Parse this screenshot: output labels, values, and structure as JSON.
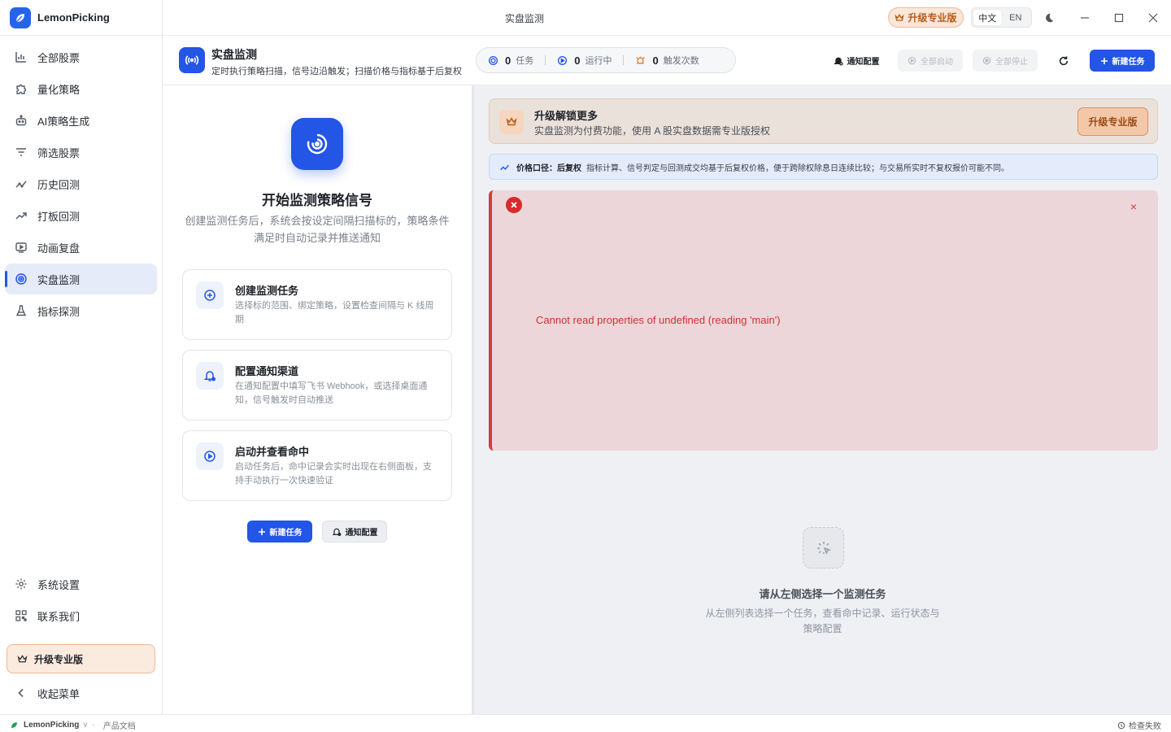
{
  "app": {
    "name": "LemonPicking",
    "window_title": "实盘监测"
  },
  "titlebar": {
    "pro_label": "升级专业版",
    "lang_zh": "中文",
    "lang_en": "EN"
  },
  "sidebar": {
    "items": [
      {
        "label": "全部股票",
        "icon": "bar-chart-icon"
      },
      {
        "label": "量化策略",
        "icon": "puzzle-icon"
      },
      {
        "label": "AI策略生成",
        "icon": "robot-icon"
      },
      {
        "label": "筛选股票",
        "icon": "filter-icon"
      },
      {
        "label": "历史回测",
        "icon": "trend-line-icon"
      },
      {
        "label": "打板回测",
        "icon": "trend-up-icon"
      },
      {
        "label": "动画复盘",
        "icon": "play-screen-icon"
      },
      {
        "label": "实盘监测",
        "icon": "radar-icon",
        "active": true
      },
      {
        "label": "指标探测",
        "icon": "flask-icon"
      }
    ],
    "settings_label": "系统设置",
    "contact_label": "联系我们",
    "upgrade_label": "升级专业版",
    "collapse_label": "收起菜单"
  },
  "header": {
    "title": "实盘监测",
    "subtitle": "定时执行策略扫描，信号边沿触发；扫描价格与指标基于后复权",
    "stats": [
      {
        "value": "0",
        "label": "任务"
      },
      {
        "value": "0",
        "label": "运行中"
      },
      {
        "value": "0",
        "label": "触发次数"
      }
    ],
    "notify_label": "通知配置",
    "start_all_label": "全部启动",
    "stop_all_label": "全部停止",
    "new_task_label": "新建任务"
  },
  "left": {
    "hero_title": "开始监测策略信号",
    "hero_desc": "创建监测任务后，系统会按设定间隔扫描标的，策略条件满足时自动记录并推送通知",
    "steps": [
      {
        "title": "创建监测任务",
        "desc": "选择标的范围、绑定策略，设置检查间隔与 K 线周期"
      },
      {
        "title": "配置通知渠道",
        "desc": "在通知配置中填写飞书 Webhook，或选择桌面通知，信号触发时自动推送"
      },
      {
        "title": "启动并查看命中",
        "desc": "启动任务后，命中记录会实时出现在右侧面板，支持手动执行一次快速验证"
      }
    ],
    "new_task_label": "新建任务",
    "notify_label": "通知配置"
  },
  "right": {
    "upgrade_title": "升级解锁更多",
    "upgrade_desc": "实盘监测为付费功能，使用 A 股实盘数据需专业版授权",
    "upgrade_btn": "升级专业版",
    "price_label": "价格口径：后复权",
    "price_desc": "指标计算、信号判定与回测成交均基于后复权价格，便于跨除权除息日连续比较；与交易所实时不复权报价可能不同。",
    "error_message": "Cannot read properties of undefined (reading 'main')",
    "error_close": "×",
    "empty_title": "请从左侧选择一个监测任务",
    "empty_desc": "从左侧列表选择一个任务，查看命中记录、运行状态与策略配置"
  },
  "statusbar": {
    "app": "LemonPicking",
    "version": "v",
    "sep": "·",
    "docs": "产品文档",
    "check": "检查失败"
  },
  "colors": {
    "primary": "#2355e6",
    "pro": "#b85a18",
    "error": "#d93a3a"
  }
}
